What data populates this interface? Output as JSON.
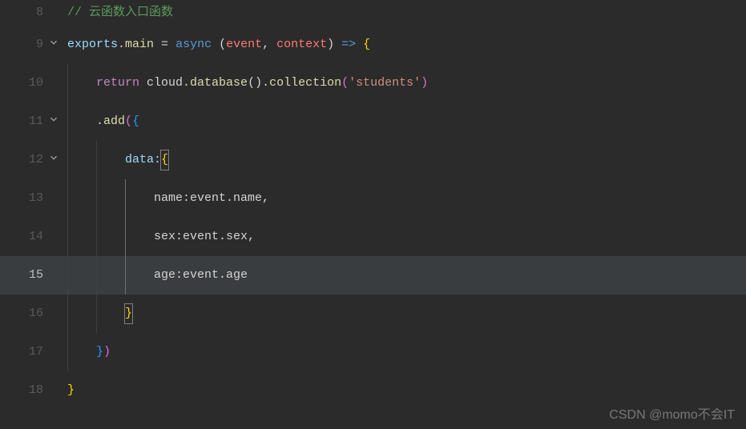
{
  "lines": {
    "8": {
      "comment": "// 云函数入口函数"
    },
    "9": {
      "t1": "exports",
      "t2": ".",
      "t3": "main",
      "t4": " = ",
      "t5": "async",
      "t6": " (",
      "t7": "event",
      "t8": ", ",
      "t9": "context",
      "t10": ") ",
      "t11": "=>",
      "t12": " {"
    },
    "10": {
      "t1": "return",
      "t2": " cloud.",
      "t3": "database",
      "t4": "().",
      "t5": "collection",
      "t6": "(",
      "t7": "'students'",
      "t8": ")"
    },
    "11": {
      "t1": ".",
      "t2": "add",
      "t3": "(",
      "t4": "{",
      "end": ""
    },
    "12": {
      "t1": "data:",
      "t2": "{",
      "end": ""
    },
    "13": {
      "t1": "name:event.name,"
    },
    "14": {
      "t1": "sex:event.sex,"
    },
    "15": {
      "t1": "age:event.age"
    },
    "16": {
      "t1": "}",
      "end": ""
    },
    "17": {
      "t1": "}",
      "t2": ")"
    },
    "18": {
      "t1": "}"
    }
  },
  "lineNumbers": [
    "8",
    "9",
    "10",
    "11",
    "12",
    "13",
    "14",
    "15",
    "16",
    "17",
    "18"
  ],
  "watermark": "CSDN @momo不会IT"
}
